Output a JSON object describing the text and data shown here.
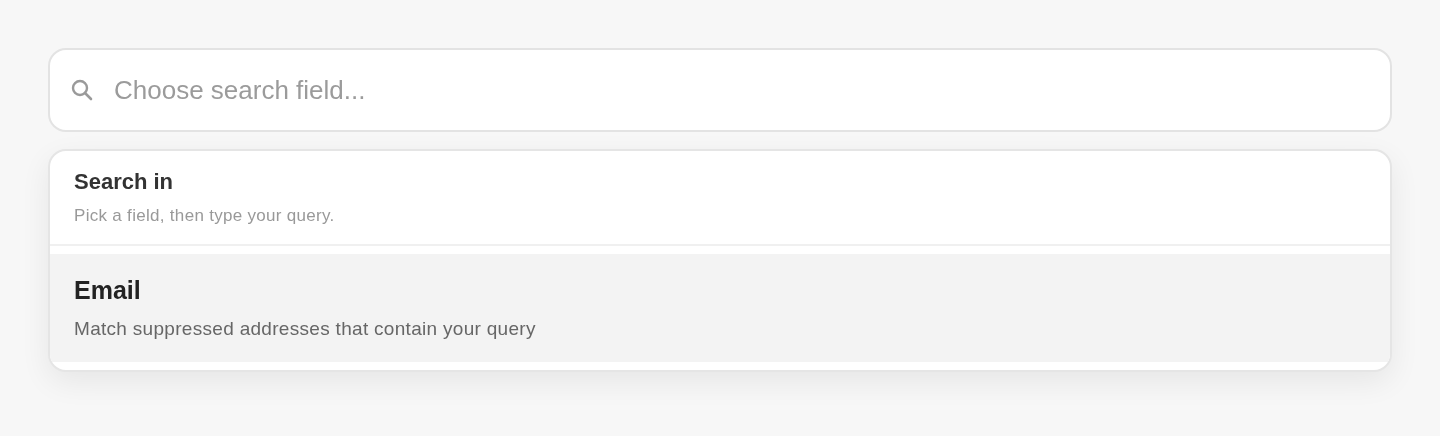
{
  "search": {
    "placeholder": "Choose search field..."
  },
  "dropdown": {
    "title": "Search in",
    "subtitle": "Pick a field, then type your query.",
    "options": [
      {
        "label": "Email",
        "description": "Match suppressed addresses that contain your query",
        "selected": true
      }
    ]
  }
}
